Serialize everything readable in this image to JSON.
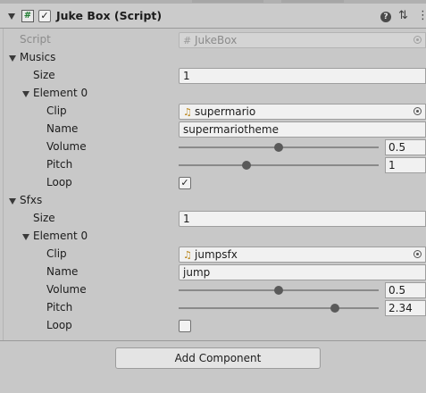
{
  "header": {
    "title": "Juke Box (Script)",
    "enabled_glyph": "✓",
    "script_glyph": "#",
    "icons": [
      "help-icon",
      "settings-sliders-icon",
      "more-vertical-icon"
    ]
  },
  "script_field": {
    "label": "Script",
    "value": "JukeBox"
  },
  "musics": {
    "label": "Musics",
    "size_label": "Size",
    "size_value": "1",
    "element": {
      "label": "Element 0",
      "clip_label": "Clip",
      "clip_value": "supermario",
      "name_label": "Name",
      "name_value": "supermariotheme",
      "volume_label": "Volume",
      "volume_value": "0.5",
      "volume_fraction": 0.5,
      "pitch_label": "Pitch",
      "pitch_value": "1",
      "pitch_fraction": 0.34,
      "loop_label": "Loop",
      "loop_checked": true
    }
  },
  "sfxs": {
    "label": "Sfxs",
    "size_label": "Size",
    "size_value": "1",
    "element": {
      "label": "Element 0",
      "clip_label": "Clip",
      "clip_value": "jumpsfx",
      "name_label": "Name",
      "name_value": "jump",
      "volume_label": "Volume",
      "volume_value": "0.5",
      "volume_fraction": 0.5,
      "pitch_label": "Pitch",
      "pitch_value": "2.34",
      "pitch_fraction": 0.78,
      "loop_label": "Loop",
      "loop_checked": false
    }
  },
  "add_component_label": "Add Component",
  "check_glyph": "✓"
}
